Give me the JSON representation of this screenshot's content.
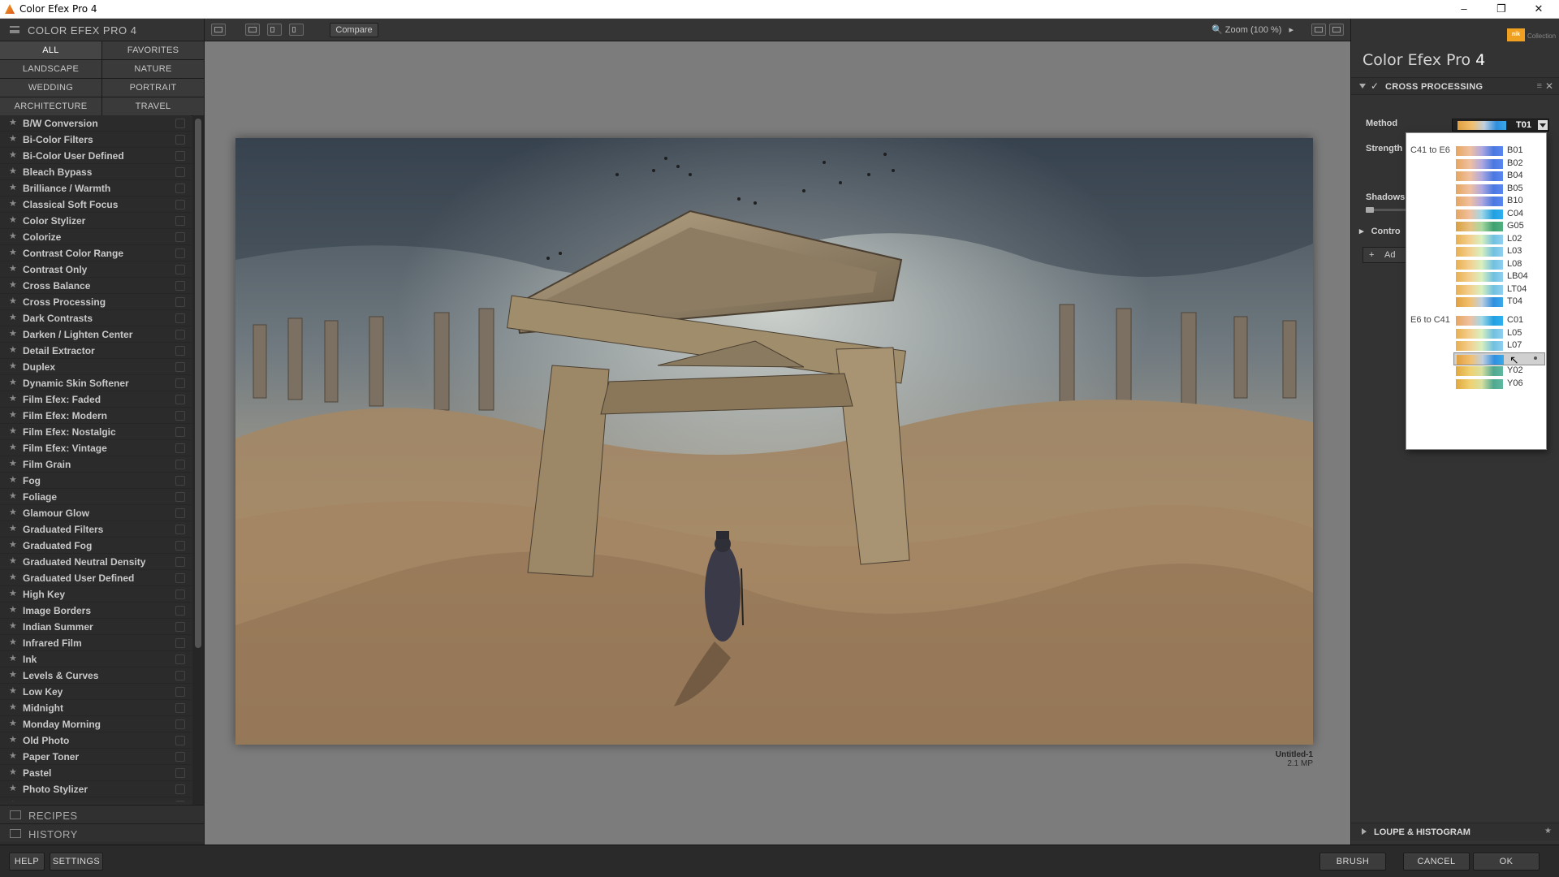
{
  "window": {
    "title": "Color Efex Pro 4",
    "controls": [
      "minimize-icon",
      "restore-icon",
      "close-icon"
    ]
  },
  "left_panel": {
    "title": "COLOR EFEX PRO 4",
    "categories": [
      {
        "label": "ALL",
        "active": true
      },
      {
        "label": "FAVORITES",
        "active": false
      },
      {
        "label": "LANDSCAPE",
        "active": false
      },
      {
        "label": "NATURE",
        "active": false
      },
      {
        "label": "WEDDING",
        "active": false
      },
      {
        "label": "PORTRAIT",
        "active": false
      },
      {
        "label": "ARCHITECTURE",
        "active": false
      },
      {
        "label": "TRAVEL",
        "active": false
      }
    ],
    "filters": [
      "B/W Conversion",
      "Bi-Color Filters",
      "Bi-Color User Defined",
      "Bleach Bypass",
      "Brilliance / Warmth",
      "Classical Soft Focus",
      "Color Stylizer",
      "Colorize",
      "Contrast Color Range",
      "Contrast Only",
      "Cross Balance",
      "Cross Processing",
      "Dark Contrasts",
      "Darken / Lighten Center",
      "Detail Extractor",
      "Duplex",
      "Dynamic Skin Softener",
      "Film Efex: Faded",
      "Film Efex: Modern",
      "Film Efex: Nostalgic",
      "Film Efex: Vintage",
      "Film Grain",
      "Fog",
      "Foliage",
      "Glamour Glow",
      "Graduated Filters",
      "Graduated Fog",
      "Graduated Neutral Density",
      "Graduated User Defined",
      "High Key",
      "Image Borders",
      "Indian Summer",
      "Infrared Film",
      "Ink",
      "Levels & Curves",
      "Low Key",
      "Midnight",
      "Monday Morning",
      "Old Photo",
      "Paper Toner",
      "Pastel",
      "Photo Stylizer",
      "Polarization"
    ],
    "recipes_label": "RECIPES",
    "history_label": "HISTORY"
  },
  "toolbar": {
    "compare_label": "Compare",
    "zoom_label": "Zoom (100 %)"
  },
  "image": {
    "name": "Untitled-1",
    "size": "2.1 MP"
  },
  "right_panel": {
    "logo_nik": "nik",
    "logo_collection": "Collection",
    "title_main": "Color Efex Pro",
    "title_num": "4",
    "filter_title": "CROSS PROCESSING",
    "method_label": "Method",
    "method_value": "T01",
    "strength_label": "Strength",
    "shadows_label": "Shadows",
    "control_points_label": "Contro",
    "add_filter_label": "Ad",
    "loupe_label": "LOUPE & HISTOGRAM"
  },
  "method_popup": {
    "groups": [
      {
        "label": "C41 to E6",
        "items": [
          "B01",
          "B02",
          "B04",
          "B05",
          "B10",
          "C04",
          "G05",
          "L02",
          "L03",
          "L08",
          "LB04",
          "LT04",
          "T04"
        ]
      },
      {
        "label": "E6 to C41",
        "items": [
          "C01",
          "L05",
          "L07",
          "T01",
          "Y02",
          "Y06"
        ]
      }
    ],
    "selected": "T01"
  },
  "bottom": {
    "help_label": "HELP",
    "settings_label": "SETTINGS",
    "brush_label": "BRUSH",
    "cancel_label": "CANCEL",
    "ok_label": "OK"
  },
  "colors": {
    "accent_logo": "#f0a020",
    "panel_bg": "#2d2d2d",
    "canvas_bg": "#7c7c7c"
  }
}
